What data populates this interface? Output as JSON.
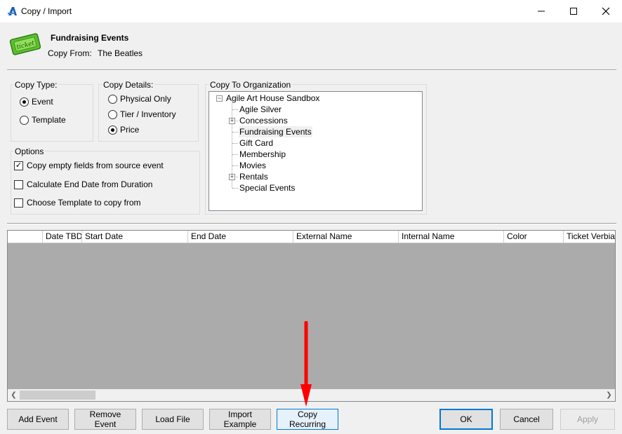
{
  "window": {
    "title": "Copy / Import",
    "controls": [
      "minimize-icon",
      "maximize-icon",
      "close-icon"
    ]
  },
  "header": {
    "icon": "ticket-icon",
    "icon_text": "ticket",
    "title": "Fundraising Events",
    "copy_from_label": "Copy From:",
    "copy_from_value": "The Beatles"
  },
  "copy_type": {
    "label": "Copy Type:",
    "options": [
      {
        "label": "Event",
        "selected": true
      },
      {
        "label": "Template",
        "selected": false
      }
    ]
  },
  "copy_details": {
    "label": "Copy Details:",
    "options": [
      {
        "label": "Physical Only",
        "selected": false
      },
      {
        "label": "Tier / Inventory",
        "selected": false
      },
      {
        "label": "Price",
        "selected": true
      }
    ]
  },
  "options": {
    "label": "Options",
    "items": [
      {
        "label": "Copy empty fields from source event",
        "checked": true
      },
      {
        "label": "Calculate End Date from Duration",
        "checked": false
      },
      {
        "label": "Choose Template to copy from",
        "checked": false
      }
    ]
  },
  "copy_to": {
    "label": "Copy To Organization",
    "root": "Agile Art House Sandbox",
    "children": [
      {
        "label": "Agile Silver",
        "expandable": false,
        "selected": false
      },
      {
        "label": "Concessions",
        "expandable": true,
        "selected": false
      },
      {
        "label": "Fundraising Events",
        "expandable": false,
        "selected": true
      },
      {
        "label": "Gift Card",
        "expandable": false,
        "selected": false
      },
      {
        "label": "Membership",
        "expandable": false,
        "selected": false
      },
      {
        "label": "Movies",
        "expandable": false,
        "selected": false
      },
      {
        "label": "Rentals",
        "expandable": true,
        "selected": false
      },
      {
        "label": "Special Events",
        "expandable": false,
        "selected": false
      }
    ]
  },
  "grid": {
    "columns": [
      "",
      "Date TBD",
      "Start Date",
      "End Date",
      "External Name",
      "Internal Name",
      "Color",
      "Ticket Verbiage"
    ],
    "rows": []
  },
  "buttons": {
    "add_event": "Add Event",
    "remove_event": "Remove Event",
    "load_file": "Load File",
    "import_example": "Import Example",
    "copy_recurring": "Copy Recurring",
    "ok": "OK",
    "cancel": "Cancel",
    "apply": "Apply"
  },
  "colors": {
    "accent": "#0078d7",
    "annotation_arrow": "#ff0000",
    "grid_background": "#ababab"
  }
}
